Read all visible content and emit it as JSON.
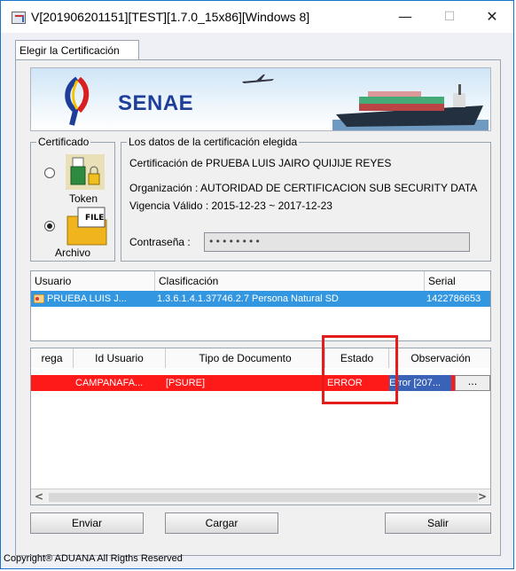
{
  "window": {
    "title": "V[201906201151][TEST][1.7.0_15x86][Windows 8]",
    "minimize": "—",
    "maximize": "☐",
    "close": "✕"
  },
  "tabs": [
    {
      "label": "Elegir la Certificación"
    }
  ],
  "banner": {
    "logo_text": "SENAE"
  },
  "certificado": {
    "legend": "Certificado",
    "options": [
      {
        "label": "Token",
        "selected": false
      },
      {
        "label": "Archivo",
        "selected": true
      }
    ],
    "file_icon_text": "FILE"
  },
  "datos": {
    "legend": "Los datos de la certificación elegida",
    "certificacion": "Certificación de PRUEBA LUIS JAIRO QUIJIJE REYES",
    "organizacion": "Organización : AUTORIDAD DE CERTIFICACION SUB SECURITY DATA",
    "vigencia": "Vigencia Válido : 2015-12-23 ~ 2017-12-23",
    "password_label": "Contraseña :",
    "password_value": "••••••••"
  },
  "cert_table": {
    "headers": [
      "Usuario",
      "Clasificación",
      "Serial"
    ],
    "rows": [
      {
        "usuario": "PRUEBA LUIS J...",
        "clasificacion": "1.3.6.1.4.1.37746.2.7 Persona Natural SD",
        "serial": "1422786653"
      }
    ]
  },
  "doc_table": {
    "headers": [
      "rega",
      "Id Usuario",
      "Tipo de Documento",
      "Estado",
      "Observación"
    ],
    "rows": [
      {
        "entrega": "",
        "id_usuario": "CAMPANAFA...",
        "tipo": "[PSURE]",
        "estado": "ERROR",
        "observacion": "Error [207...",
        "more": "..."
      }
    ]
  },
  "scroll": {
    "left": "<",
    "right": ">"
  },
  "buttons": {
    "enviar": "Enviar",
    "cargar": "Cargar",
    "salir": "Salir"
  },
  "footer": "Copyright® ADUANA All Rigths Reserved",
  "colors": {
    "selection": "#3396e0",
    "error_row": "#ff1a1a",
    "highlight_box": "#e51c1c",
    "brand": "#1e3e9a"
  }
}
